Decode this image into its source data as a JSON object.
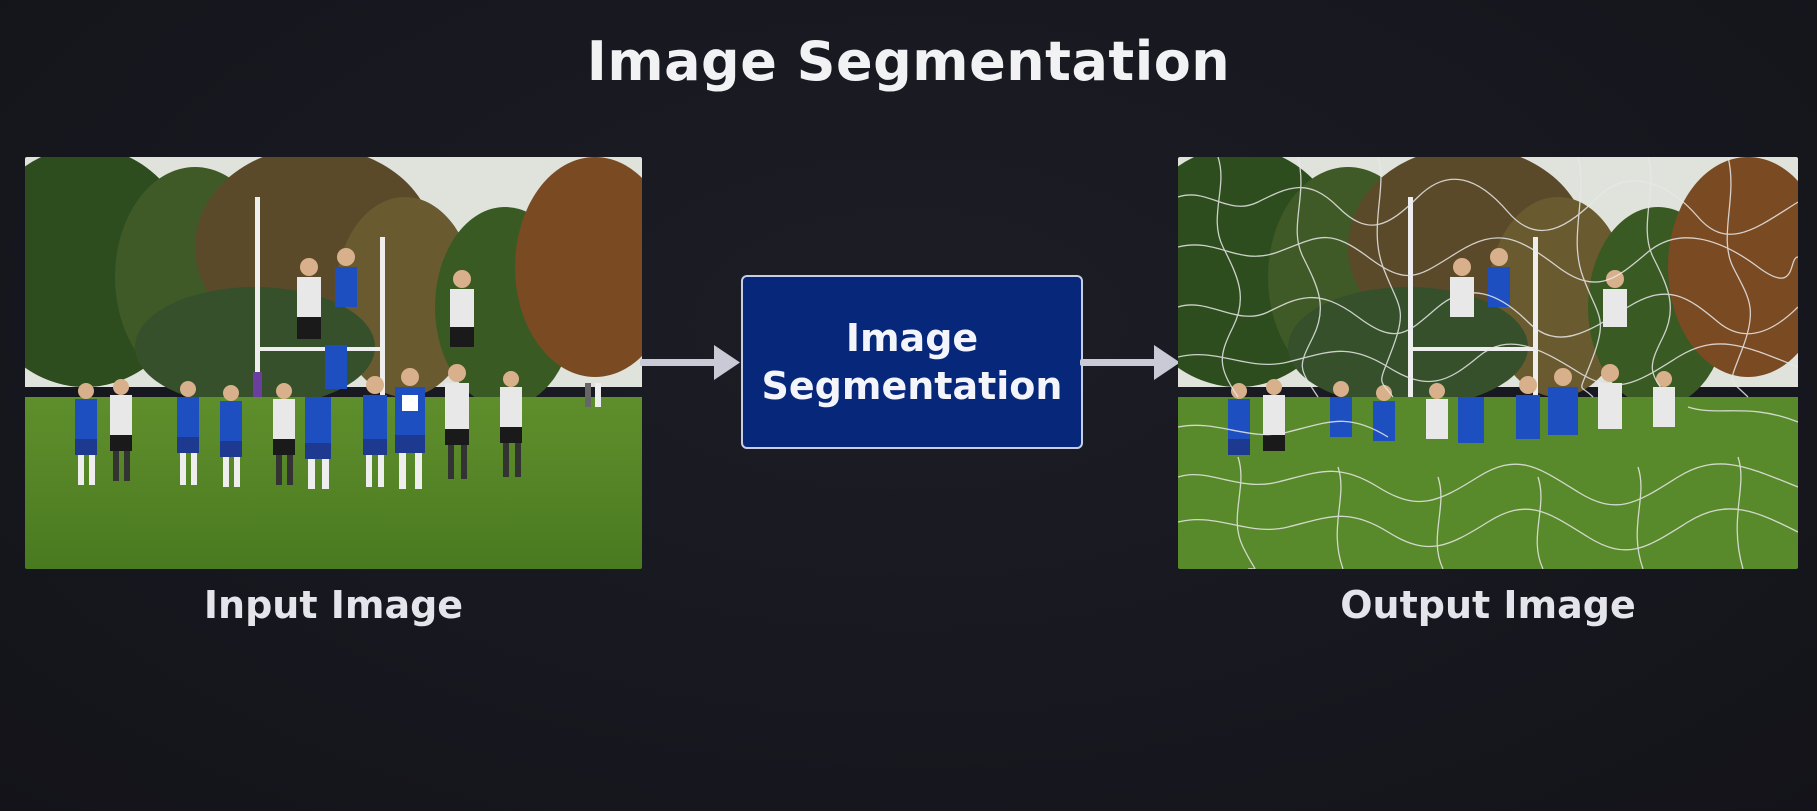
{
  "title": "Image Segmentation",
  "input": {
    "caption": "Input Image"
  },
  "process": {
    "line1": "Image",
    "line2": "Segmentation"
  },
  "output": {
    "caption": "Output Image"
  },
  "colors": {
    "background": "#17171f",
    "process_box": "#06277a",
    "arrow": "#c9cad6",
    "segment_lines": "#e8e8e8"
  },
  "icons": {
    "arrow_in": "right-arrow-icon",
    "arrow_out": "right-arrow-icon"
  }
}
